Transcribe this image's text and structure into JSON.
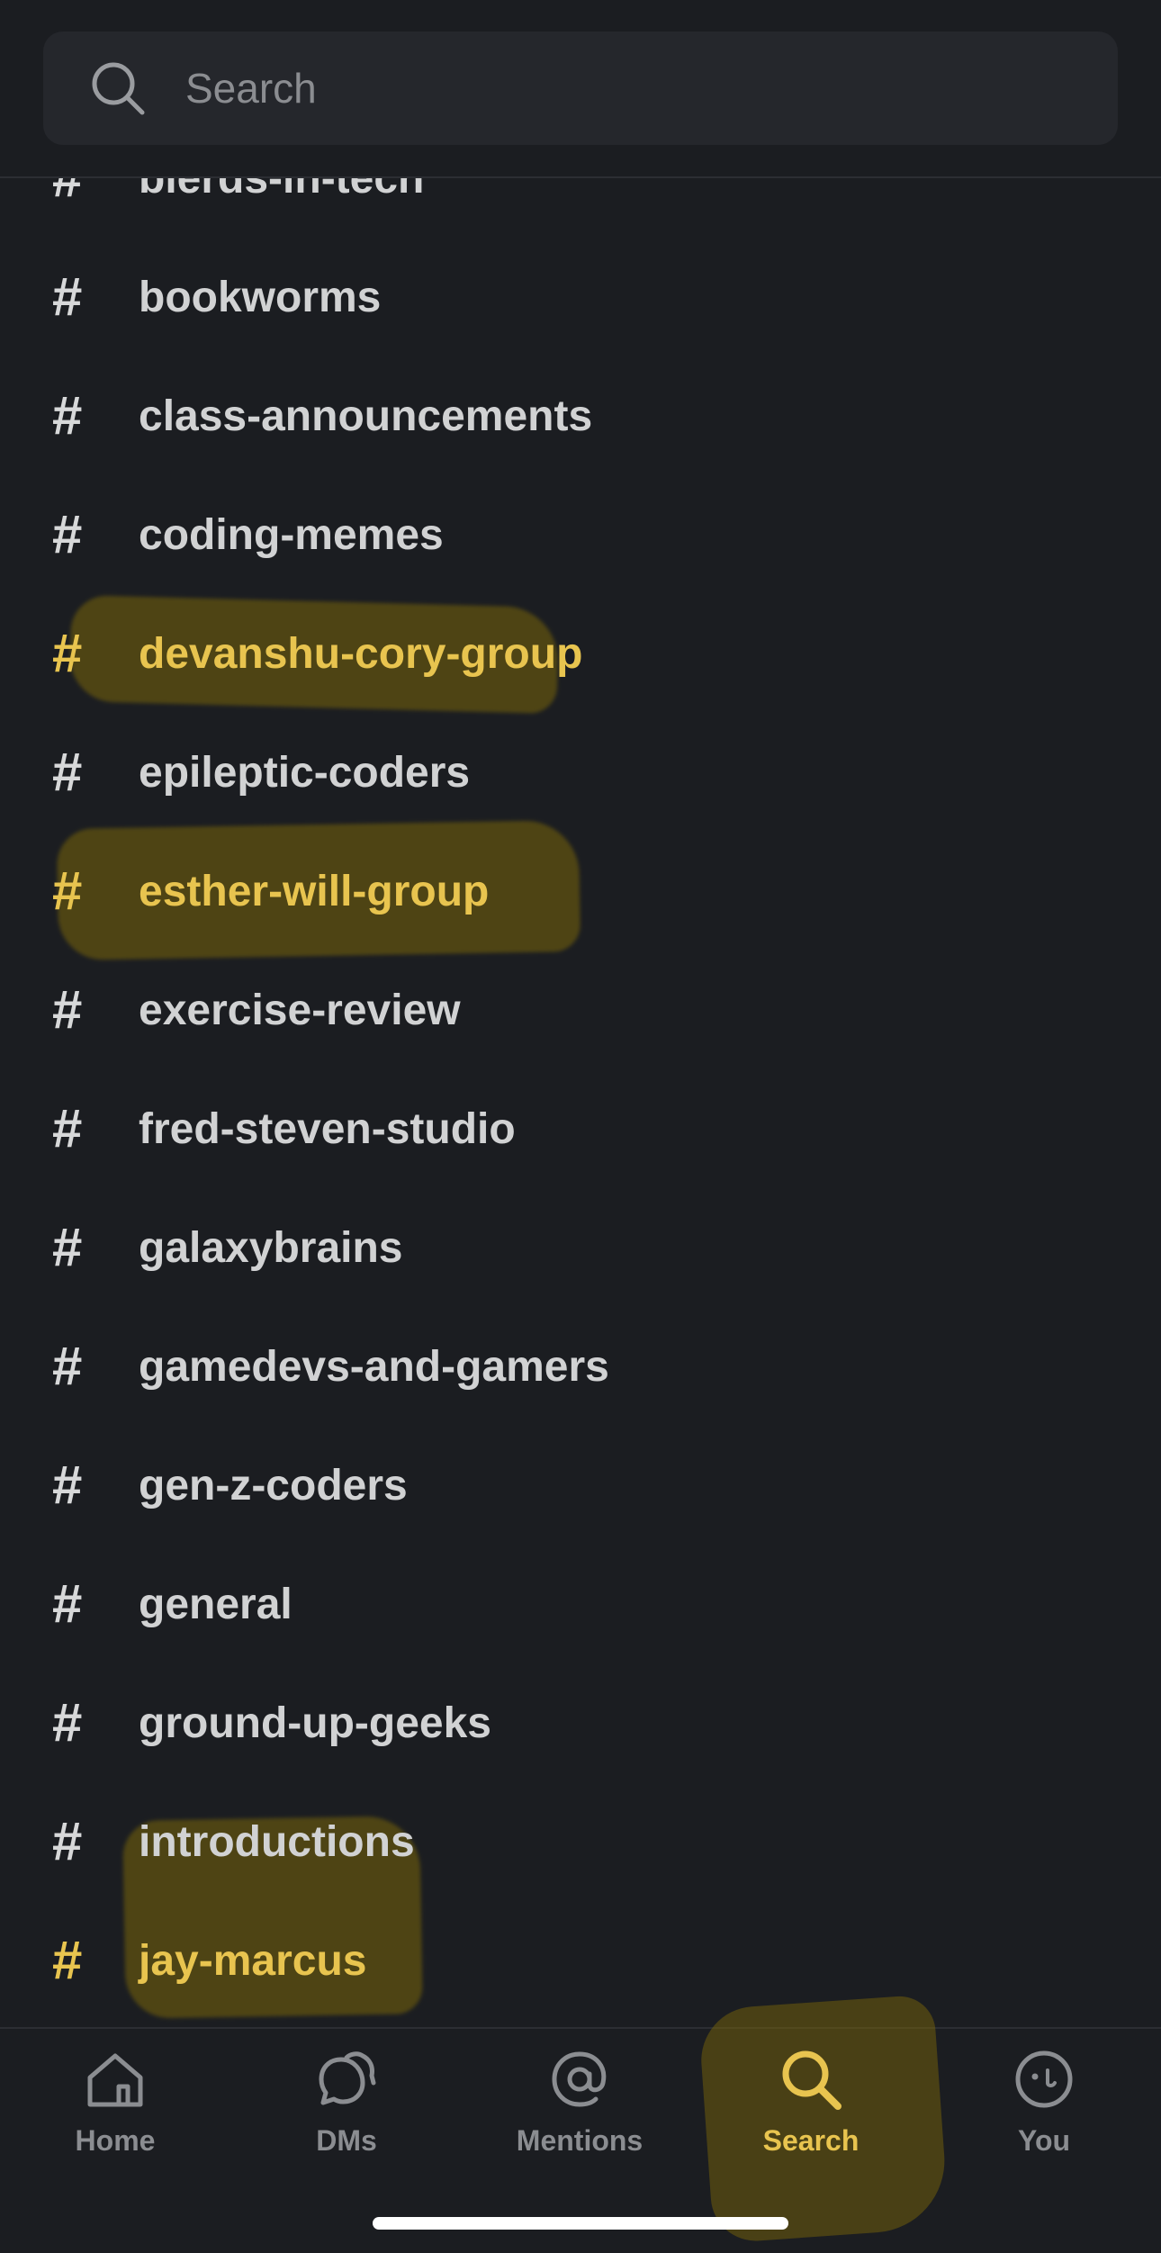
{
  "search": {
    "placeholder": "Search"
  },
  "channels": [
    {
      "name": "blerds-in-tech",
      "highlighted": false
    },
    {
      "name": "bookworms",
      "highlighted": false
    },
    {
      "name": "class-announcements",
      "highlighted": false
    },
    {
      "name": "coding-memes",
      "highlighted": false
    },
    {
      "name": "devanshu-cory-group",
      "highlighted": true
    },
    {
      "name": "epileptic-coders",
      "highlighted": false
    },
    {
      "name": "esther-will-group",
      "highlighted": true
    },
    {
      "name": "exercise-review",
      "highlighted": false
    },
    {
      "name": "fred-steven-studio",
      "highlighted": false
    },
    {
      "name": "galaxybrains",
      "highlighted": false
    },
    {
      "name": "gamedevs-and-gamers",
      "highlighted": false
    },
    {
      "name": "gen-z-coders",
      "highlighted": false
    },
    {
      "name": "general",
      "highlighted": false
    },
    {
      "name": "ground-up-geeks",
      "highlighted": false
    },
    {
      "name": "introductions",
      "highlighted": false
    },
    {
      "name": "jay-marcus",
      "highlighted": true
    }
  ],
  "channel_prefix": "#",
  "tabs": [
    {
      "label": "Home",
      "icon": "home-icon",
      "active": false
    },
    {
      "label": "DMs",
      "icon": "dms-icon",
      "active": false
    },
    {
      "label": "Mentions",
      "icon": "at-sign-icon",
      "active": false
    },
    {
      "label": "Search",
      "icon": "search-icon",
      "active": true
    },
    {
      "label": "You",
      "icon": "face-icon",
      "active": false
    }
  ],
  "colors": {
    "background": "#1b1d21",
    "highlight_text": "#e8c44f",
    "text": "#d1d2d3",
    "inactive_tab": "#8b8d91"
  }
}
